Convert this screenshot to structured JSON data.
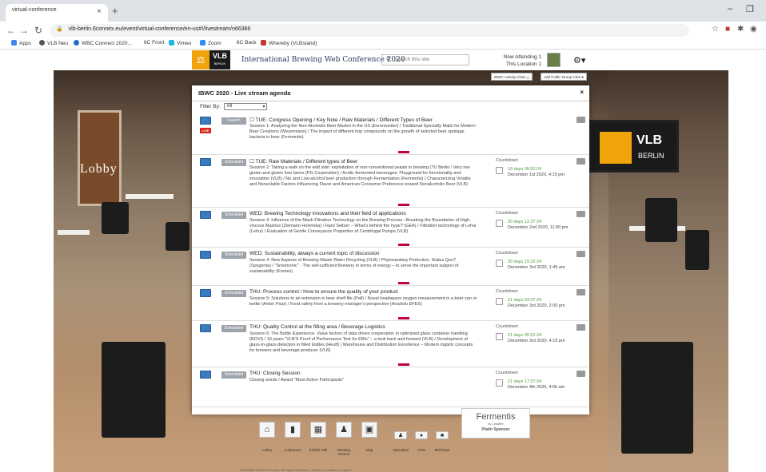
{
  "browser": {
    "tab_title": "virtual-conference",
    "tab_close": "×",
    "new_tab": "+",
    "url": "vlb-berlin.6connex.eu/event/virtual-conference/en-us#!/livestream/n66366",
    "bookmarks": [
      "Apps",
      "VLB Neu",
      "WBC Connect 2020...",
      "6C Front",
      "Vimeo",
      "Zoom",
      "6C Back",
      "Whereby (VLBstand)"
    ]
  },
  "site": {
    "logo_top": "VLB",
    "logo_bottom": "BERLIN",
    "title": "International Brewing Web Conference 2020",
    "search_placeholder": "Search this site",
    "now_attending_label": "Now Attending",
    "now_attending_count": "1",
    "this_location_label": "This Location",
    "this_location_count": "1",
    "activity_chart_btn": "IBWC Activity Chart",
    "public_group_chat_btn": "Add Public Group Chat"
  },
  "lobby": {
    "label": "Lobby",
    "screen_brand": "VLB",
    "screen_city": "BERLIN"
  },
  "modal": {
    "title": "IBWC 2020 - Live stream agenda",
    "close": "×",
    "filter_label": "Filter By",
    "filter_value": "All",
    "countdown_label": "Countdown",
    "sessions": [
      {
        "status": "Launch",
        "live": "LIVE",
        "title": "TUE: Congress Opening / Key Note / Raw Materials / Different Types of Beer",
        "desc": "Session 1: Analyzing the Non-Alcoholic Beer Market in the US (Euromonitor) / Traditional Specialty Malts for Modern Beer Creations (Weyermann) / The impact of different hop compounds on the growth of selected beer spoilage bacteria in beer (Fermentis)",
        "countdown": "",
        "date": ""
      },
      {
        "status": "Scheduled",
        "live": "",
        "title": "TUE: Raw Materials / Different types of Beer",
        "desc": "Session 2: Taking a walk on the wild side: exploitation of non-conventional yeasts in brewing (TU Berlin / Very low gluten and gluten free beers (PG Corporation) / Acidic fermented beverages: Playground for functionality and innovation (VLB) / No and Low-alcohol beer production through Fermentation (Fermentis) / Characterizing Volatile and Nonvolatile Factors Influencing Flavor and American Consumer Preference toward Nonalcoholic Beer (VLB)",
        "countdown": "19 days 05:52:24",
        "date": "December 1st 2020, 4:15 pm"
      },
      {
        "status": "Scheduled",
        "live": "",
        "title": "WED: Brewing Technology innovations and their field of applications",
        "desc": "Session 3: Influence of the Mash Filtration Technology on the Brewing Process –Breaking the Boundaries of High-viscous Mashes (Ziemann Holvrieka) / Hard Seltzer – What's behind the hype? (GEA) / Filtration technology of Lehui (Lehui) / Evaluation of Gentle Conveyance Properties of Centrifugal Pumps (VLB)",
        "countdown": "20 days 12:37:24",
        "date": "December 2nd 2020, 11:00 pm"
      },
      {
        "status": "Scheduled",
        "live": "",
        "title": "WED: Sustainability, always a current topic of discussion",
        "desc": "Session 4: New Aspects of Brewing Waste Water Recycling (VLB) / Phytosanitary Protection, Status Quo? (Syngenta) / \"Sreomonic\" - The self-sufficient Brewery in terms of energy – to serve the important subject of sustainability (Krones)",
        "countdown": "20 days 15:22:24",
        "date": "December 3rd 2020, 1:45 am"
      },
      {
        "status": "Scheduled",
        "live": "",
        "title": "THU: Process control / How to ensure the quality of your product",
        "desc": "Session 5: Solutions to an extension in beer shelf life (Pall) / Novel headspace oxygen measurement in a beer can or bottle (Anton Paar) / Food safety from a brewery manager's perspective (Anadolu EFES)",
        "countdown": "21 days 03:37:24",
        "date": "December 3rd 2020, 2:00 pm"
      },
      {
        "status": "Scheduled",
        "live": "",
        "title": "THU: Quality Control at the filling area / Beverage Logistics",
        "desc": "Session 6: The Bottle Experience. Value factors of data driven cooperation in optimized glass container handling (ROVI) / 10 years \"VLB'S Proof of Performance Test for EBIs\" – a look back and forward (VLB) / Development of glass-in-glass detection in filled bottles (Heuft) / Warehouse and Distribution Excellence – Modern logistic concepts for brewers and beverage producer (VLB)",
        "countdown": "21 days 05:52:24",
        "date": "December 3rd 2020, 4:15 pm"
      },
      {
        "status": "Scheduled",
        "live": "",
        "title": "THU: Closing Session",
        "desc": "Closing words / Award \"Most Active Participants\"",
        "countdown": "21 days 17:37:24",
        "date": "December 4th 2020, 4:00 am"
      }
    ]
  },
  "sponsor": {
    "name": "Fermentis",
    "sub": "by Lesaffre",
    "level": "Platin Sponsor"
  },
  "nav": [
    "Lobby",
    "Auditorium",
    "Exhibit Hall",
    "Meeting Rooms",
    "Map",
    "Attendees",
    "Chat",
    "Briefcase"
  ],
  "footer": "6CONNEX  ©2020 6Connex. All Rights Reserved  |  Terms & Condition  |  Support"
}
